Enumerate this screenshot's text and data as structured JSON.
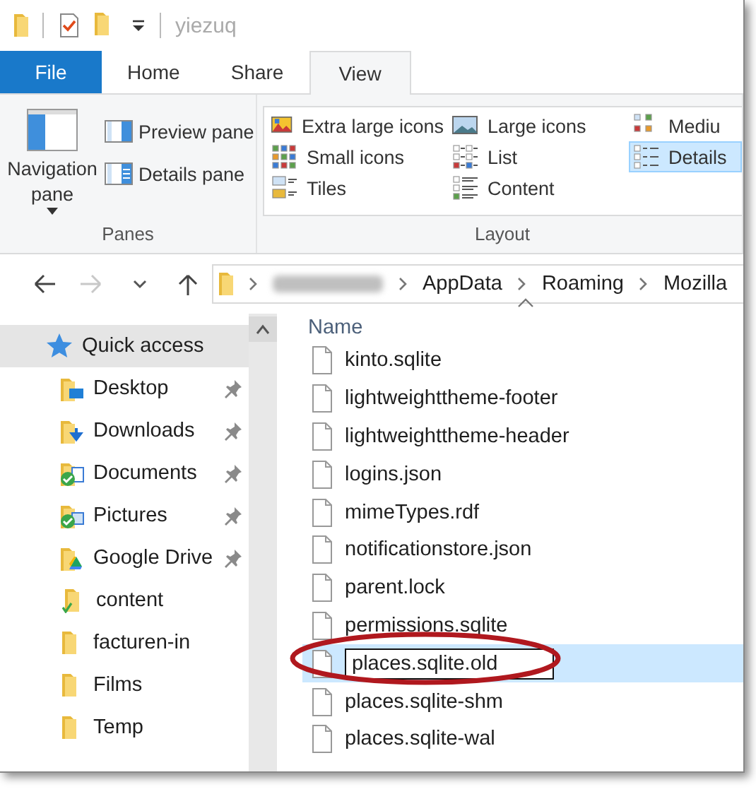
{
  "window": {
    "title": "yiezuq"
  },
  "tabs": [
    {
      "label": "File",
      "kind": "file",
      "selected": false
    },
    {
      "label": "Home",
      "kind": "tab",
      "selected": false
    },
    {
      "label": "Share",
      "kind": "tab",
      "selected": false
    },
    {
      "label": "View",
      "kind": "tab",
      "selected": true
    }
  ],
  "ribbon": {
    "panes": {
      "label": "Panes",
      "navigation_pane": "Navigation pane",
      "items": [
        {
          "label": "Preview pane"
        },
        {
          "label": "Details pane"
        }
      ]
    },
    "layout": {
      "label": "Layout",
      "options": [
        {
          "label": "Extra large icons",
          "selected": false
        },
        {
          "label": "Small icons",
          "selected": false
        },
        {
          "label": "Tiles",
          "selected": false
        },
        {
          "label": "Large icons",
          "selected": false
        },
        {
          "label": "List",
          "selected": false
        },
        {
          "label": "Content",
          "selected": false
        },
        {
          "label": "Mediu",
          "selected": false
        },
        {
          "label": "Details",
          "selected": true
        }
      ]
    }
  },
  "address": {
    "path": [
      "AppData",
      "Roaming",
      "Mozilla"
    ]
  },
  "sidebar": {
    "items": [
      {
        "label": "Quick access",
        "pinned": false,
        "selected": true
      },
      {
        "label": "Desktop",
        "pinned": true,
        "selected": false
      },
      {
        "label": "Downloads",
        "pinned": true,
        "selected": false
      },
      {
        "label": "Documents",
        "pinned": true,
        "selected": false
      },
      {
        "label": "Pictures",
        "pinned": true,
        "selected": false
      },
      {
        "label": "Google Drive",
        "pinned": true,
        "selected": false
      },
      {
        "label": "content",
        "pinned": false,
        "selected": false
      },
      {
        "label": "facturen-in",
        "pinned": false,
        "selected": false
      },
      {
        "label": "Films",
        "pinned": false,
        "selected": false
      },
      {
        "label": "Temp",
        "pinned": false,
        "selected": false
      }
    ]
  },
  "table": {
    "columns": [
      "Name"
    ],
    "rows": [
      {
        "name": "kinto.sqlite",
        "selected": false,
        "renaming": false
      },
      {
        "name": "lightweighttheme-footer",
        "selected": false,
        "renaming": false
      },
      {
        "name": "lightweighttheme-header",
        "selected": false,
        "renaming": false
      },
      {
        "name": "logins.json",
        "selected": false,
        "renaming": false
      },
      {
        "name": "mimeTypes.rdf",
        "selected": false,
        "renaming": false
      },
      {
        "name": "notificationstore.json",
        "selected": false,
        "renaming": false
      },
      {
        "name": "parent.lock",
        "selected": false,
        "renaming": false
      },
      {
        "name": "permissions.sqlite",
        "selected": false,
        "renaming": false
      },
      {
        "name": "places.sqlite.old",
        "selected": true,
        "renaming": true
      },
      {
        "name": "places.sqlite-shm",
        "selected": false,
        "renaming": false
      },
      {
        "name": "places.sqlite-wal",
        "selected": false,
        "renaming": false
      }
    ]
  }
}
